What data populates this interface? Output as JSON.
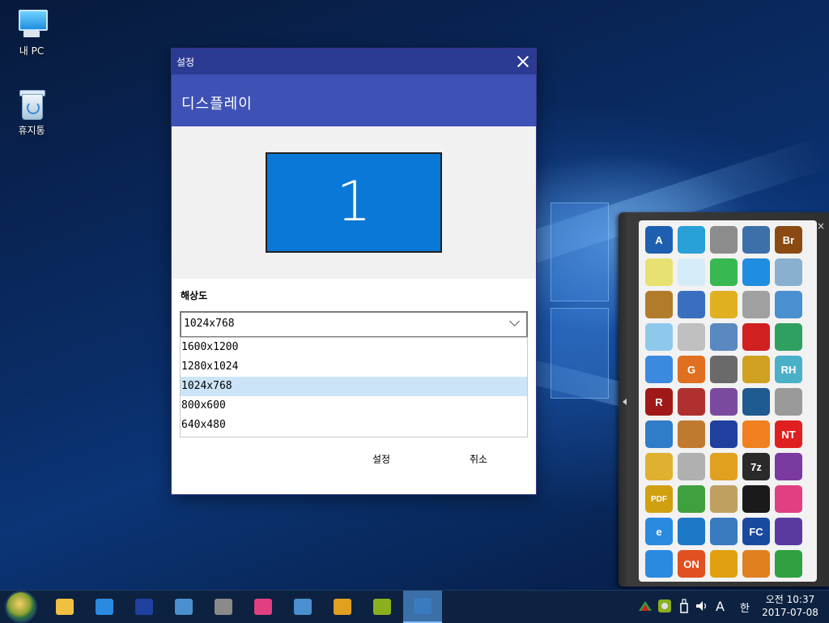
{
  "desktop": {
    "icons": [
      {
        "label": "내 PC"
      },
      {
        "label": "휴지통"
      }
    ]
  },
  "dialog": {
    "title": "설정",
    "header": "디스플레이",
    "monitor_number": "1",
    "resolution_label": "해상도",
    "selected_resolution": "1024x768",
    "options": [
      "1600x1200",
      "1280x1024",
      "1024x768",
      "800x600",
      "640x480"
    ],
    "ok_label": "설정",
    "cancel_label": "취소"
  },
  "launcher": {
    "close_glyph": "×",
    "tiles": [
      {
        "icon": "letter-a-icon",
        "text": "A",
        "bg": "#1f5fb0"
      },
      {
        "icon": "sync-icon",
        "text": "",
        "bg": "#29a0d8"
      },
      {
        "icon": "hard-drive-icon",
        "text": "",
        "bg": "#8c8c8c"
      },
      {
        "icon": "backup-drive-icon",
        "text": "",
        "bg": "#3d6fa8"
      },
      {
        "icon": "bridge-br-icon",
        "text": "Br",
        "bg": "#8a4a12"
      },
      {
        "icon": "ghost-icon",
        "text": "",
        "bg": "#e8e070"
      },
      {
        "icon": "ghost-explorer-icon",
        "text": "",
        "bg": "#d5ecf8"
      },
      {
        "icon": "ghost-play-icon",
        "text": "",
        "bg": "#38b850"
      },
      {
        "icon": "windows-logo-icon",
        "text": "",
        "bg": "#1f8de0"
      },
      {
        "icon": "network-drive-icon",
        "text": "",
        "bg": "#8ab0d0"
      },
      {
        "icon": "package-installer-icon",
        "text": "",
        "bg": "#b27b2c"
      },
      {
        "icon": "windows-update-icon",
        "text": "",
        "bg": "#3a6fc0"
      },
      {
        "icon": "refresh-gear-icon",
        "text": "",
        "bg": "#e0b020"
      },
      {
        "icon": "usb-lock-icon",
        "text": "",
        "bg": "#a0a0a0"
      },
      {
        "icon": "usb-cable-icon",
        "text": "",
        "bg": "#4a90d0"
      },
      {
        "icon": "document-icon",
        "text": "",
        "bg": "#8ec8ea"
      },
      {
        "icon": "chip-tool-icon",
        "text": "",
        "bg": "#c0c0c0"
      },
      {
        "icon": "computer-icon",
        "text": "",
        "bg": "#5a88c0"
      },
      {
        "icon": "ladybug-icon",
        "text": "",
        "bg": "#d02020"
      },
      {
        "icon": "disk-chart-icon",
        "text": "",
        "bg": "#30a060"
      },
      {
        "icon": "magic-wand-icon",
        "text": "",
        "bg": "#3a8ae0"
      },
      {
        "icon": "letter-g-icon",
        "text": "G",
        "bg": "#e07020"
      },
      {
        "icon": "disk-tool-icon",
        "text": "",
        "bg": "#6a6a6a"
      },
      {
        "icon": "registry-icon",
        "text": "",
        "bg": "#d0a020"
      },
      {
        "icon": "letters-rh-icon",
        "text": "RH",
        "bg": "#4ab0c8"
      },
      {
        "icon": "letter-r-icon",
        "text": "R",
        "bg": "#a01818"
      },
      {
        "icon": "registry-cubes-icon",
        "text": "",
        "bg": "#b03030"
      },
      {
        "icon": "disc-icon",
        "text": "",
        "bg": "#7a4aa0"
      },
      {
        "icon": "hdd-clock-icon",
        "text": "",
        "bg": "#1f5a90"
      },
      {
        "icon": "usb-stick-icon",
        "text": "",
        "bg": "#9a9a9a"
      },
      {
        "icon": "usb-windows-icon",
        "text": "",
        "bg": "#2f7cc8"
      },
      {
        "icon": "download-box-icon",
        "text": "",
        "bg": "#c07a30"
      },
      {
        "icon": "floppy-save-icon",
        "text": "",
        "bg": "#2040a0"
      },
      {
        "icon": "search-magnifier-icon",
        "text": "",
        "bg": "#f08020"
      },
      {
        "icon": "nt-password-icon",
        "text": "NT",
        "bg": "#e02020"
      },
      {
        "icon": "key-icon",
        "text": "",
        "bg": "#e0b030"
      },
      {
        "icon": "trash-can-icon",
        "text": "",
        "bg": "#b0b0b0"
      },
      {
        "icon": "magic-stars-icon",
        "text": "",
        "bg": "#e0a020"
      },
      {
        "icon": "7zip-icon",
        "text": "7z",
        "bg": "#2a2a2a"
      },
      {
        "icon": "winrar-books-icon",
        "text": "",
        "bg": "#7a3aa0"
      },
      {
        "icon": "pdf-icon",
        "text": "PDF",
        "bg": "#d0a010"
      },
      {
        "icon": "pie-chart-icon",
        "text": "",
        "bg": "#40a040"
      },
      {
        "icon": "network-map-icon",
        "text": "",
        "bg": "#c0a060"
      },
      {
        "icon": "monitor-icon",
        "text": "",
        "bg": "#1a1a1a"
      },
      {
        "icon": "color-spectrum-icon",
        "text": "",
        "bg": "#e04080"
      },
      {
        "icon": "internet-explorer-icon",
        "text": "e",
        "bg": "#2a8ae0"
      },
      {
        "icon": "teamviewer-icon",
        "text": "",
        "bg": "#1e78c8"
      },
      {
        "icon": "network-nodes-icon",
        "text": "",
        "bg": "#3a7ac0"
      },
      {
        "icon": "letters-fc-icon",
        "text": "FC",
        "bg": "#1a4aa0"
      },
      {
        "icon": "cpu-chip-icon",
        "text": "",
        "bg": "#5a3aa0"
      },
      {
        "icon": "play-triangle-icon",
        "text": "",
        "bg": "#2a8ae0"
      },
      {
        "icon": "on-media-icon",
        "text": "ON",
        "bg": "#e05020"
      },
      {
        "icon": "aimp-icon",
        "text": "",
        "bg": "#e0a010"
      },
      {
        "icon": "game-face-icon",
        "text": "",
        "bg": "#e08020"
      },
      {
        "icon": "utorrent-icon",
        "text": "",
        "bg": "#30a040"
      }
    ]
  },
  "taskbar": {
    "items": [
      {
        "name": "file-explorer-icon",
        "color": "#f0c040"
      },
      {
        "name": "internet-explorer-icon",
        "color": "#2a8ae0"
      },
      {
        "name": "floppy-save-icon",
        "color": "#2040a0"
      },
      {
        "name": "search-magnifier-icon",
        "color": "#4a90d0"
      },
      {
        "name": "mask-app-icon",
        "color": "#8a8a8a"
      },
      {
        "name": "color-spectrum-icon",
        "color": "#e04080"
      },
      {
        "name": "network-nodes-icon",
        "color": "#4a90d0"
      },
      {
        "name": "letter-r-icon",
        "color": "#e0a020"
      },
      {
        "name": "olive-app-icon",
        "color": "#8ab020"
      },
      {
        "name": "display-settings-icon",
        "color": "#3a7ac0"
      }
    ],
    "tray": {
      "ime_mode": "A",
      "ime_lang": "한",
      "time": "오전 10:37",
      "date": "2017-07-08"
    }
  }
}
